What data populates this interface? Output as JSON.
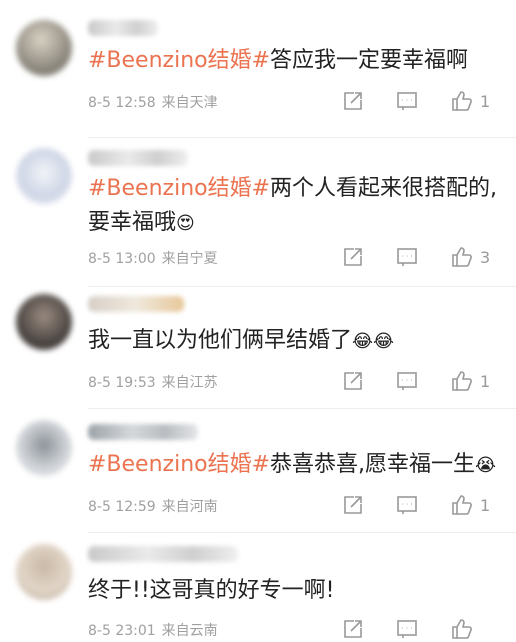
{
  "comments": [
    {
      "tag": "#Beenzino结婚#",
      "text": "答应我一定要幸福啊",
      "line2": "",
      "emoji": "",
      "date": "8-5 12:58",
      "location": "来自天津",
      "likes": "1"
    },
    {
      "tag": "#Beenzino结婚#",
      "text": "两个人看起来很搭配的,",
      "line2": "要幸福哦",
      "emoji": "😍",
      "date": "8-5 13:00",
      "location": "来自宁夏",
      "likes": "3"
    },
    {
      "tag": "",
      "text": "我一直以为他们俩早结婚了",
      "line2": "",
      "emoji": "😂😂",
      "date": "8-5 19:53",
      "location": "来自江苏",
      "likes": "1"
    },
    {
      "tag": "#Beenzino结婚#",
      "text": "恭喜恭喜,愿幸福一生",
      "line2": "",
      "emoji": "😭",
      "date": "8-5 12:59",
      "location": "来自河南",
      "likes": "1"
    },
    {
      "tag": "",
      "text": "终于!!这哥真的好专一啊!",
      "line2": "",
      "emoji": "",
      "date": "8-5 23:01",
      "location": "来自云南",
      "likes": ""
    }
  ],
  "icons": {
    "share": "share-icon",
    "comment": "comment-icon",
    "like": "thumbs-up-icon"
  },
  "colors": {
    "topic": "#eb7350",
    "meta": "#a0a0a0",
    "icon": "#999999"
  }
}
